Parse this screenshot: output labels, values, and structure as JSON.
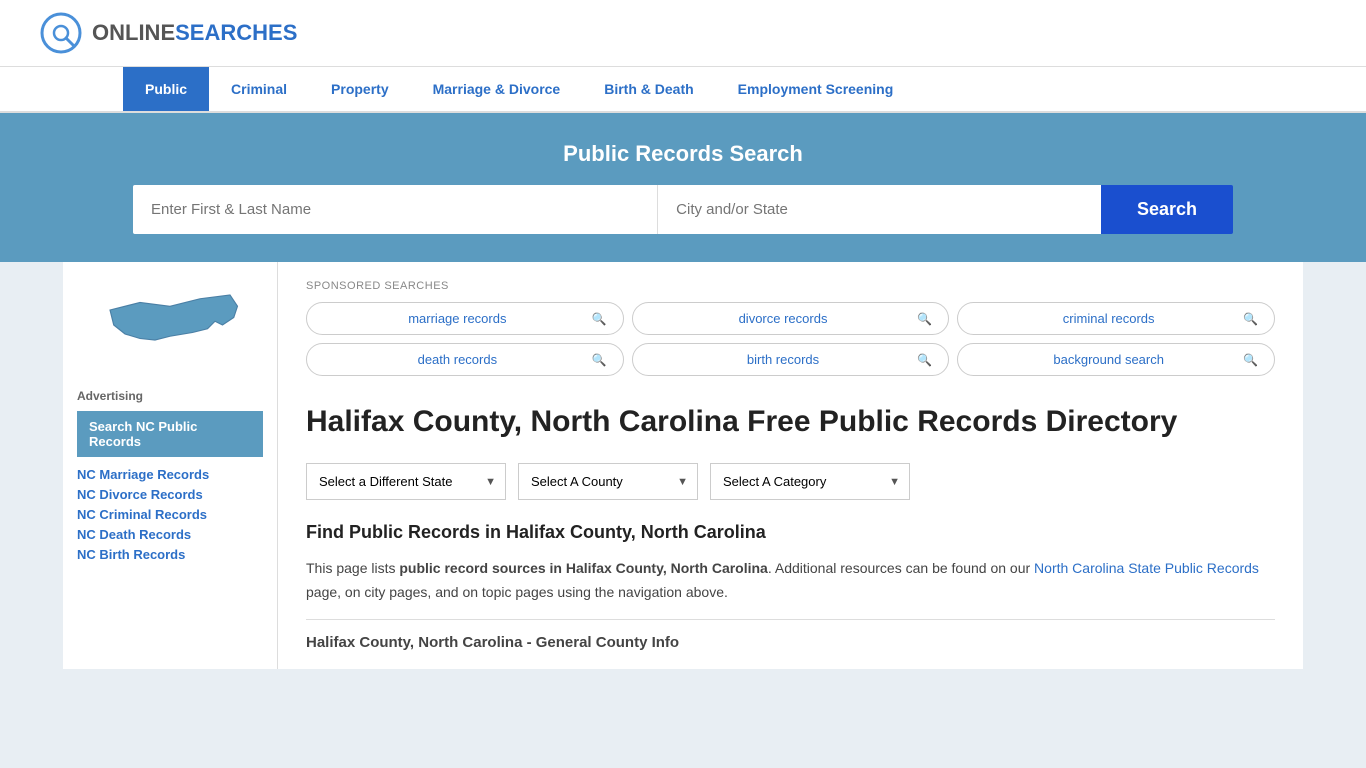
{
  "header": {
    "logo_online": "ONLINE",
    "logo_searches": "SEARCHES"
  },
  "nav": {
    "items": [
      {
        "label": "Public",
        "active": true
      },
      {
        "label": "Criminal",
        "active": false
      },
      {
        "label": "Property",
        "active": false
      },
      {
        "label": "Marriage & Divorce",
        "active": false
      },
      {
        "label": "Birth & Death",
        "active": false
      },
      {
        "label": "Employment Screening",
        "active": false
      }
    ]
  },
  "search_banner": {
    "title": "Public Records Search",
    "name_placeholder": "Enter First & Last Name",
    "location_placeholder": "City and/or State",
    "button_label": "Search"
  },
  "sponsored": {
    "label": "SPONSORED SEARCHES",
    "pills": [
      {
        "text": "marriage records"
      },
      {
        "text": "divorce records"
      },
      {
        "text": "criminal records"
      },
      {
        "text": "death records"
      },
      {
        "text": "birth records"
      },
      {
        "text": "background search"
      }
    ]
  },
  "page": {
    "title": "Halifax County, North Carolina Free Public Records Directory",
    "find_title": "Find Public Records in Halifax County, North Carolina",
    "description_part1": "This page lists ",
    "description_bold": "public record sources in Halifax County, North Carolina",
    "description_part2": ". Additional resources can be found on our ",
    "description_link": "North Carolina State Public Records",
    "description_part3": " page, on city pages, and on topic pages using the navigation above.",
    "general_info": "Halifax County, North Carolina - General County Info"
  },
  "dropdowns": {
    "state": "Select a Different State",
    "county": "Select A County",
    "category": "Select A Category"
  },
  "sidebar": {
    "ad_label": "Advertising",
    "ad_box": "Search NC Public Records",
    "links": [
      "NC Marriage Records",
      "NC Divorce Records",
      "NC Criminal Records",
      "NC Death Records",
      "NC Birth Records"
    ]
  }
}
